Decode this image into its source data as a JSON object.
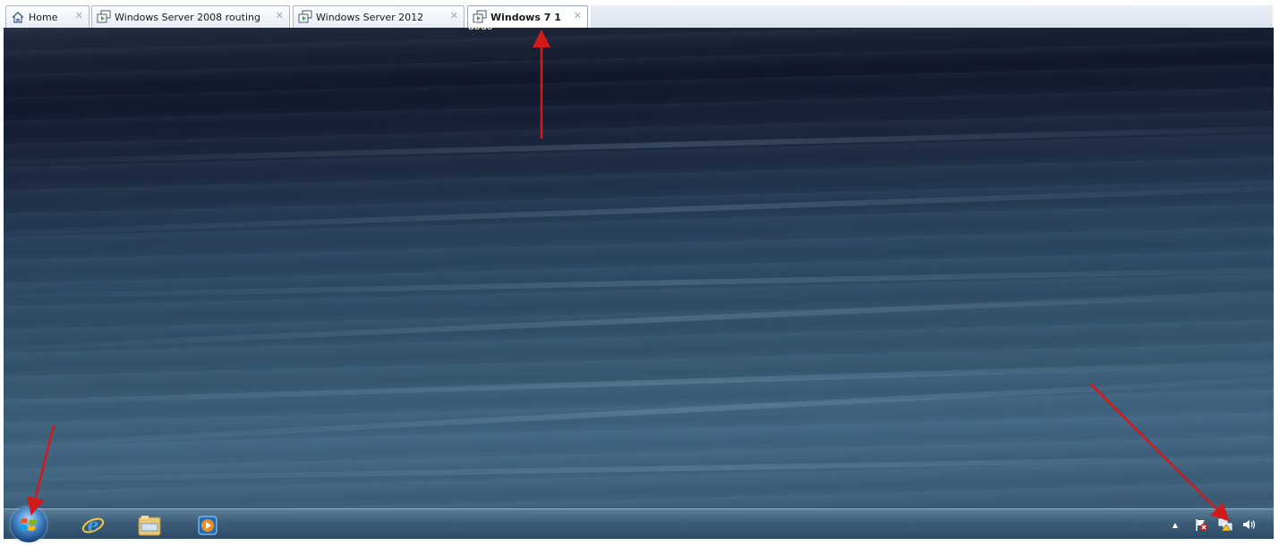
{
  "tabs": [
    {
      "label": "Home",
      "icon": "home-icon",
      "close": "✕",
      "active": false
    },
    {
      "label": "Windows Server 2008 routing",
      "icon": "vm-icon",
      "close": "✕",
      "active": false
    },
    {
      "label": "Windows Server 2012",
      "icon": "vm-icon",
      "close": "✕",
      "active": false
    },
    {
      "label": "Windows 7 1",
      "icon": "vm-icon",
      "close": "✕",
      "active": true
    }
  ],
  "active_tab_sublabel": "abdo",
  "taskbar": {
    "start_button": "windows-start-orb",
    "pinned": [
      "internet-explorer-icon",
      "file-explorer-icon",
      "media-player-icon"
    ]
  },
  "tray": {
    "show_hidden": "▲",
    "icons": [
      "action-center-flag-icon",
      "network-icon",
      "volume-icon"
    ]
  },
  "colors": {
    "annotation_arrow": "#d11a1a",
    "desktop_dark": "#10182b",
    "desktop_light": "#416683"
  }
}
